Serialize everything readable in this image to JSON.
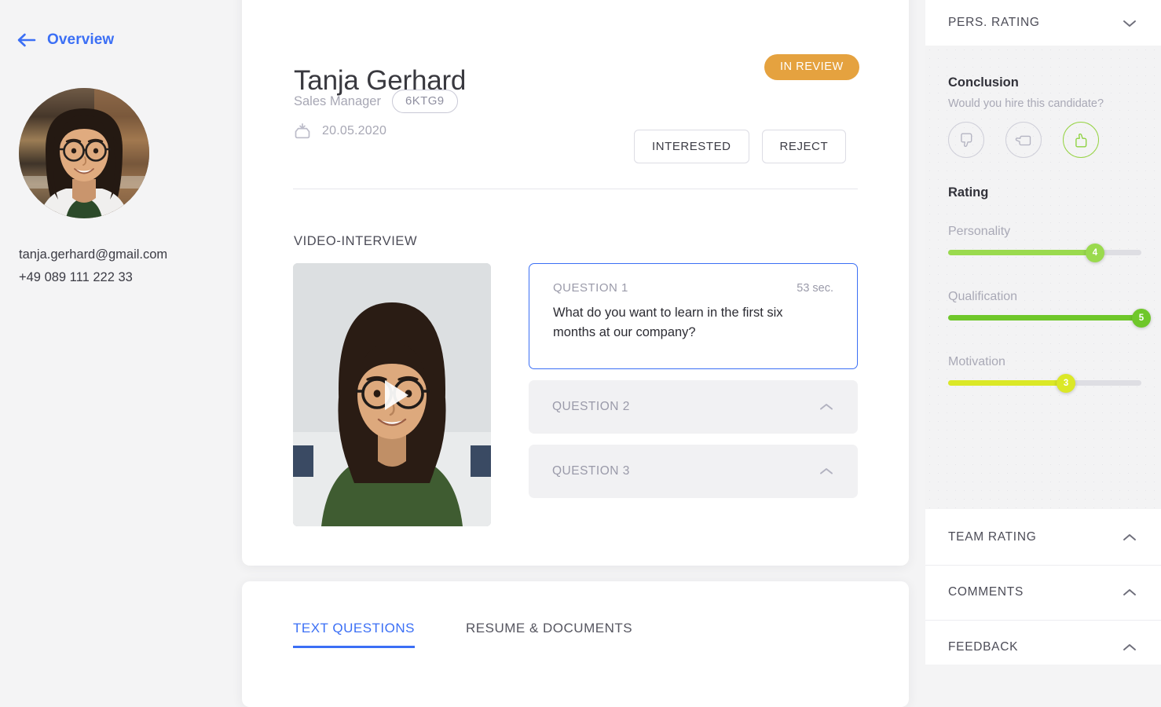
{
  "theme": {
    "accent_blue": "#3b6ff5",
    "status_orange": "#e5a23f",
    "green": "#8dd23f",
    "page_bg": "#f4f4f5"
  },
  "sidebar": {
    "back": {
      "label": "Overview",
      "icon": "arrow-left-icon"
    },
    "avatar_alt": "candidate-photo",
    "email": "tanja.gerhard@gmail.com",
    "phone": "+49 089 111 222 33"
  },
  "candidate": {
    "name": "Tanja Gerhard",
    "role": "Sales Manager",
    "code": "6KTG9",
    "status": "IN REVIEW",
    "date": "20.05.2020",
    "date_icon": "inbox-download-icon"
  },
  "actions": {
    "interested": "INTERESTED",
    "reject": "REJECT"
  },
  "video_section": {
    "title": "VIDEO-INTERVIEW",
    "play_icon": "play-icon"
  },
  "questions": [
    {
      "label": "QUESTION 1",
      "duration": "53 sec.",
      "text": "What do you want to learn in the first six months at our company?",
      "expanded": true
    },
    {
      "label": "QUESTION 2",
      "expanded": false,
      "icon": "chevron-up-icon"
    },
    {
      "label": "QUESTION 3",
      "expanded": false,
      "icon": "chevron-up-icon"
    }
  ],
  "bottom_tabs": [
    {
      "label": "TEXT QUESTIONS",
      "active": true
    },
    {
      "label": "RESUME & DOCUMENTS",
      "active": false
    }
  ],
  "right_panel": {
    "pers_rating": {
      "title": "PERS. RATING",
      "icon": "chevron-down-icon"
    },
    "conclusion": {
      "heading": "Conclusion",
      "question": "Would you hire this candidate?",
      "options": [
        {
          "name": "thumbs-down",
          "selected": false
        },
        {
          "name": "thumbs-sideways",
          "selected": false
        },
        {
          "name": "thumbs-up",
          "selected": true
        }
      ]
    },
    "rating": {
      "heading": "Rating",
      "sliders": [
        {
          "label": "Personality",
          "value": 4,
          "max": 5,
          "percent": 76,
          "color": "#9ada4e"
        },
        {
          "label": "Qualification",
          "value": 5,
          "max": 5,
          "percent": 100,
          "color": "#6fc72a"
        },
        {
          "label": "Motivation",
          "value": 3,
          "max": 5,
          "percent": 61,
          "color": "#dbe827"
        }
      ]
    },
    "sections": [
      {
        "title": "TEAM RATING",
        "icon": "chevron-up-icon"
      },
      {
        "title": "COMMENTS",
        "icon": "chevron-up-icon"
      },
      {
        "title": "FEEDBACK",
        "icon": "chevron-up-icon"
      }
    ]
  }
}
